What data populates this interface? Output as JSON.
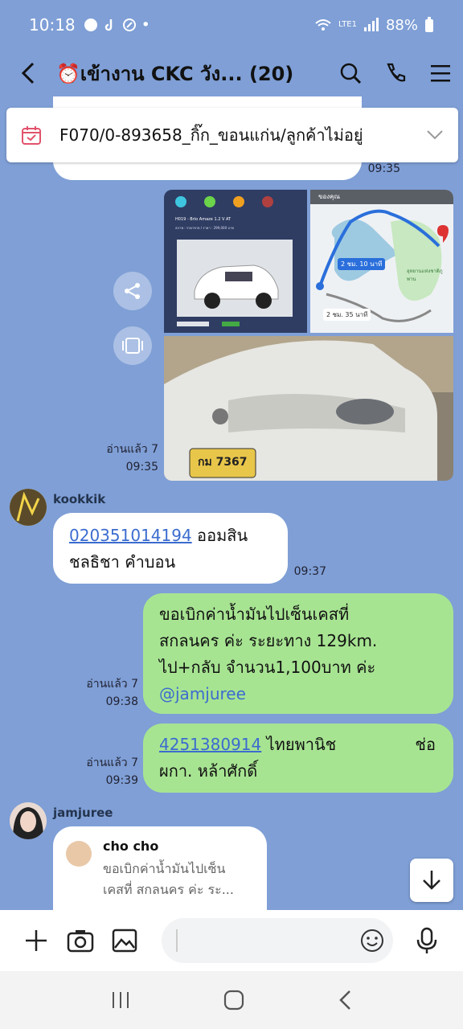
{
  "status": {
    "time": "10:18",
    "battery": "88%",
    "network": "LTE1"
  },
  "header": {
    "title": "⏰เข้างาน CKC วัง...",
    "member_count": "(20)"
  },
  "pinned": {
    "text": "F070/0-893658_กิ๊ก_ขอนแก่น/ลูกค้าไม่อยู่"
  },
  "messages": {
    "m1": {
      "time": "09:35"
    },
    "m2": {
      "read": "อ่านแล้ว 7",
      "time": "09:35",
      "car_card": {
        "title": "H019 - Brio Amaze 1.2 V AT",
        "sub": "สภาพ : ราคาขาย / ราคา : 299,000 บาท"
      },
      "map": {
        "top_label": "ของคุณ",
        "route1": "2 ชม. 10 นาที",
        "route2": "2 ชม. 35 นาที",
        "place": "อุทยานแห่งชาติภูพาน"
      },
      "plate": "กม 7367"
    },
    "m3": {
      "sender": "kookkik",
      "link": "020351014194",
      "text_a": " ออมสิน",
      "text_b": "ชลธิชา คำบอน",
      "time": "09:37"
    },
    "m4": {
      "read": "อ่านแล้ว 7",
      "time": "09:38",
      "line1": "ขอเบิกค่าน้ำมันไปเซ็นเคสที่",
      "line2": "สกลนคร ค่ะ ระยะทาง 129km.",
      "line3": "ไป+กลับ จำนวน1,100บาท ค่ะ",
      "mention": "@jamjuree"
    },
    "m5": {
      "read": "อ่านแล้ว 7",
      "time": "09:39",
      "link": "4251380914",
      "text_a": " ไทยพานิช",
      "text_b": "ช่อ",
      "line2": "ผกา. หล้าศักดิ์"
    },
    "m6": {
      "sender": "jamjuree",
      "reply_name": "cho cho",
      "reply_line1": "ขอเบิกค่าน้ำมันไปเซ็น",
      "reply_line2": "เคสที่ สกลนคร ค่ะ ระ..."
    }
  },
  "colors": {
    "background": "#7f9fd6",
    "bubble_green": "#a7e492",
    "link": "#3b6ccf"
  }
}
